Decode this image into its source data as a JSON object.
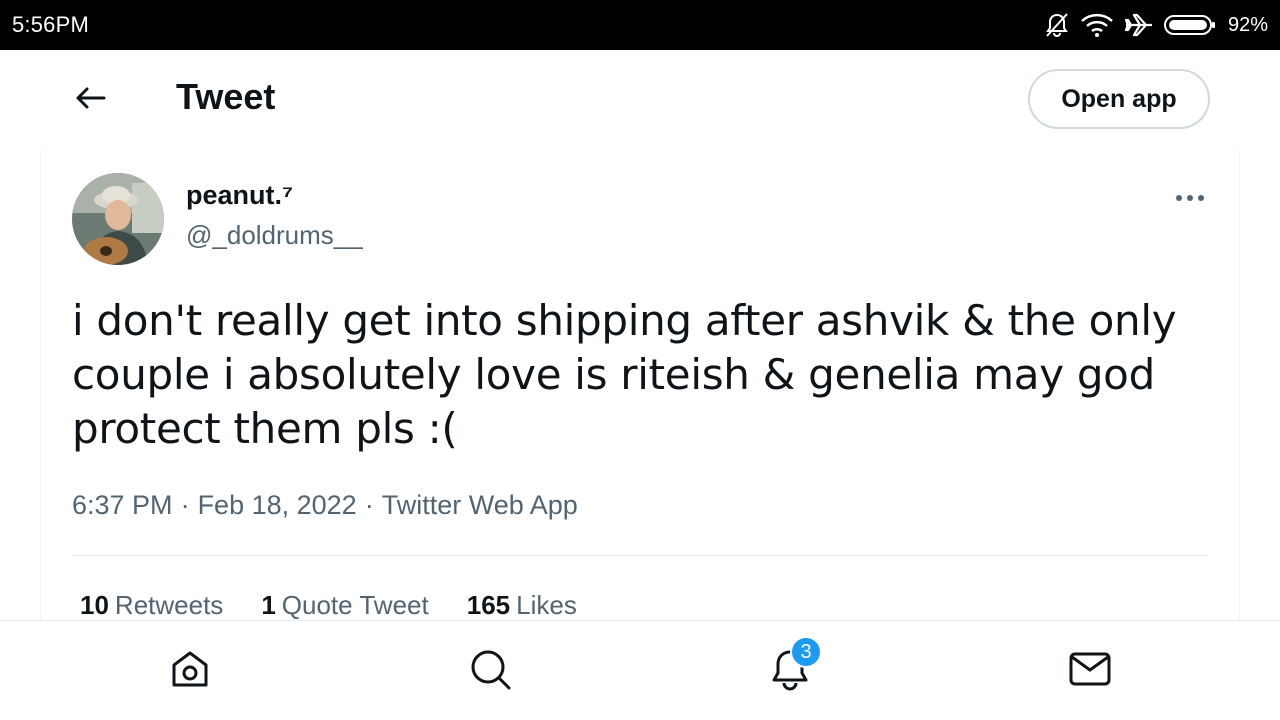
{
  "status_bar": {
    "time": "5:56PM",
    "battery": "92%",
    "icons": [
      "bell-muted-icon",
      "wifi-icon",
      "airplane-icon",
      "battery-icon"
    ]
  },
  "header": {
    "title": "Tweet",
    "open_app_label": "Open app",
    "back_icon": "back-arrow-icon"
  },
  "tweet": {
    "display_name": "peanut.⁷",
    "handle": "@_doldrums__",
    "text": "i don't really get into shipping after ashvik & the only couple i absolutely love is riteish & genelia may god protect them pls :(",
    "time": "6:37 PM",
    "date": "Feb 18, 2022",
    "source": "Twitter Web App",
    "separator": "·"
  },
  "stats": {
    "retweets_count": "10",
    "retweets_label": "Retweets",
    "quotes_count": "1",
    "quotes_label": "Quote Tweet",
    "likes_count": "165",
    "likes_label": "Likes"
  },
  "bottom_nav": {
    "items": [
      "home-icon",
      "search-icon",
      "notifications-icon",
      "messages-icon"
    ],
    "notifications_badge": "3"
  },
  "colors": {
    "accent": "#1d9bf0",
    "text_primary": "#0f1419",
    "text_secondary": "#536471"
  }
}
